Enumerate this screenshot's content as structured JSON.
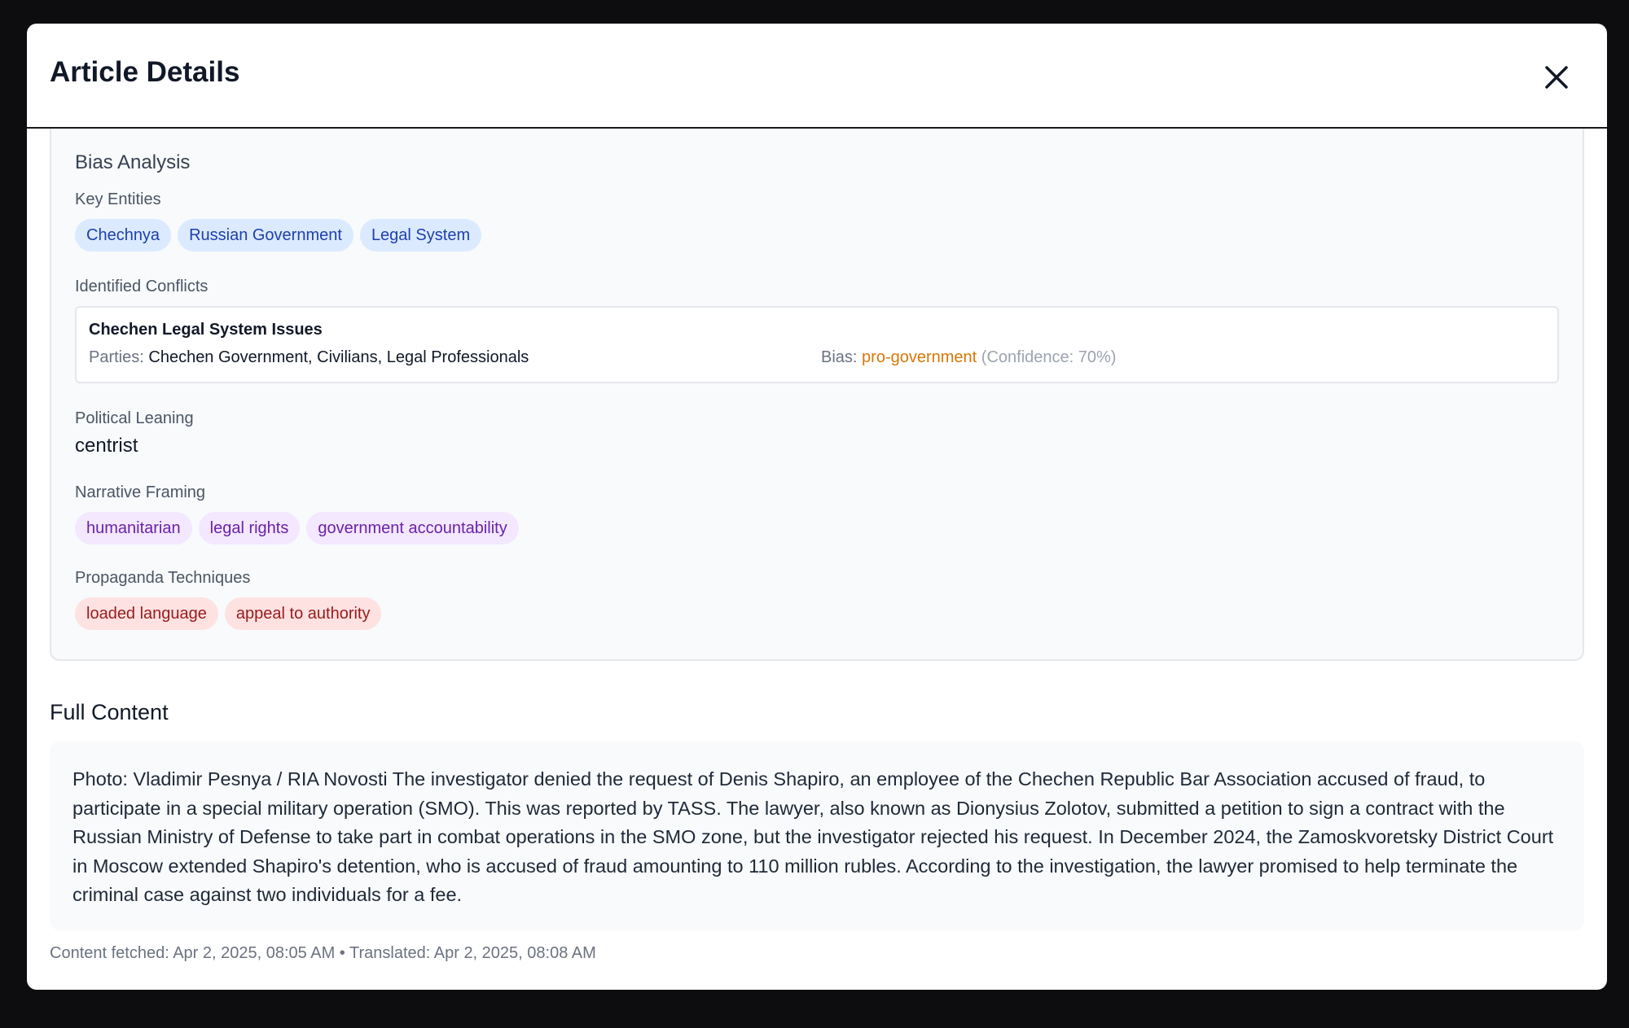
{
  "modal": {
    "title": "Article Details",
    "close_icon": "close-icon"
  },
  "bias": {
    "title": "Bias Analysis",
    "key_entities": {
      "label": "Key Entities",
      "items": [
        "Chechnya",
        "Russian Government",
        "Legal System"
      ]
    },
    "conflicts": {
      "label": "Identified Conflicts",
      "items": [
        {
          "title": "Chechen Legal System Issues",
          "parties_label": "Parties:",
          "parties": "Chechen Government, Civilians, Legal Professionals",
          "bias_label": "Bias:",
          "bias_value": "pro-government",
          "confidence": "(Confidence: 70%)"
        }
      ]
    },
    "political_leaning": {
      "label": "Political Leaning",
      "value": "centrist"
    },
    "narrative_framing": {
      "label": "Narrative Framing",
      "items": [
        "humanitarian",
        "legal rights",
        "government accountability"
      ]
    },
    "propaganda": {
      "label": "Propaganda Techniques",
      "items": [
        "loaded language",
        "appeal to authority"
      ]
    }
  },
  "content": {
    "title": "Full Content",
    "text": "Photo: Vladimir Pesnya / RIA Novosti The investigator denied the request of Denis Shapiro, an employee of the Chechen Republic Bar Association accused of fraud, to participate in a special military operation (SMO). This was reported by TASS. The lawyer, also known as Dionysius Zolotov, submitted a petition to sign a contract with the Russian Ministry of Defense to take part in combat operations in the SMO zone, but the investigator rejected his request. In December 2024, the Zamoskvoretsky District Court in Moscow extended Shapiro's detention, who is accused of fraud amounting to 110 million rubles. According to the investigation, the lawyer promised to help terminate the criminal case against two individuals for a fee.",
    "meta": "Content fetched: Apr 2, 2025, 08:05 AM • Translated: Apr 2, 2025, 08:08 AM"
  },
  "colors": {
    "entity_tag_bg": "#dbeafe",
    "framing_tag_bg": "#f3e8ff",
    "propaganda_tag_bg": "#fee2e2",
    "bias_value": "#d97706"
  }
}
